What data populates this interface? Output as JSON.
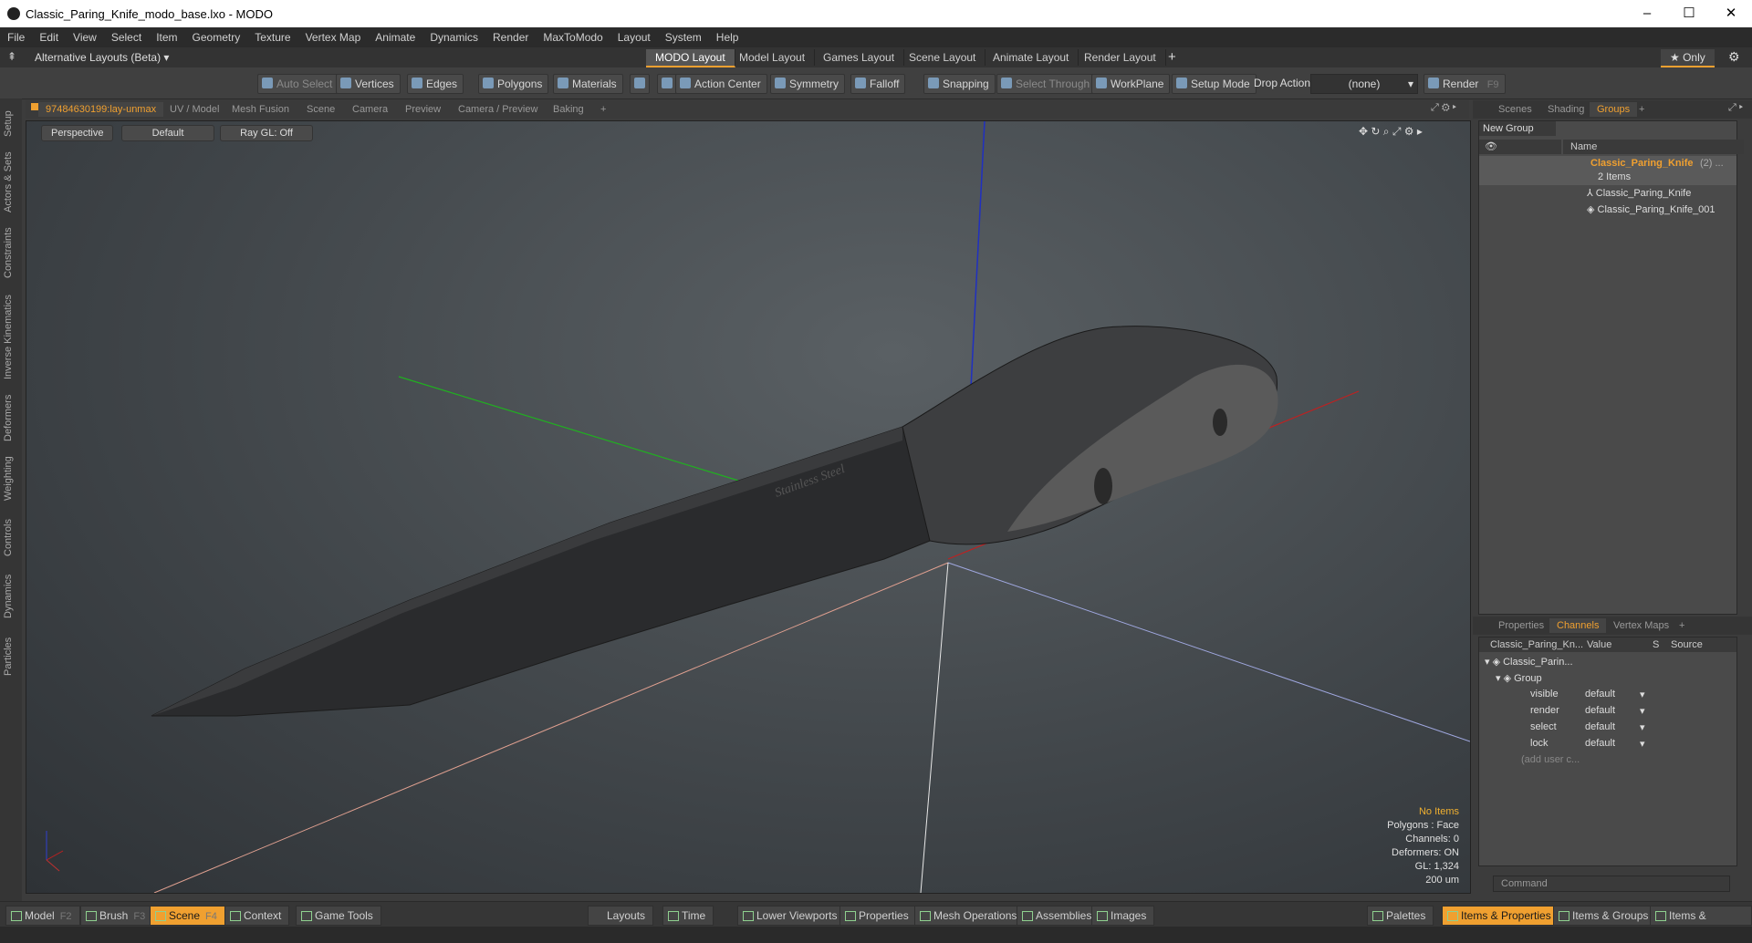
{
  "window": {
    "title": "Classic_Paring_Knife_modo_base.lxo - MODO",
    "minimize": "–",
    "maximize": "☐",
    "close": "✕"
  },
  "menu": [
    "File",
    "Edit",
    "View",
    "Select",
    "Item",
    "Geometry",
    "Texture",
    "Vertex Map",
    "Animate",
    "Dynamics",
    "Render",
    "MaxToModo",
    "Layout",
    "System",
    "Help"
  ],
  "layouts": {
    "selector": "Alternative Layouts (Beta) ▾",
    "tabs": [
      "MODO Layout",
      "Model Layout",
      "Games Layout",
      "Scene Layout",
      "Animate Layout",
      "Render Layout"
    ],
    "add": "+",
    "only": "★ Only"
  },
  "toolbar": {
    "auto_select": "Auto Select",
    "vertices": "Vertices",
    "edges": "Edges",
    "polygons": "Polygons",
    "materials": "Materials",
    "action_center": "Action Center",
    "symmetry": "Symmetry",
    "falloff": "Falloff",
    "snapping": "Snapping",
    "select_through": "Select Through",
    "workplane": "WorkPlane",
    "setup_mode": "Setup Mode",
    "drop_action": "Drop Action",
    "drop_value": "(none)",
    "render": "Render",
    "render_key": "F9"
  },
  "left_tabs": [
    "Setup",
    "Actors & Sets",
    "Constraints",
    "Inverse Kinematics",
    "Deformers",
    "Weighting",
    "Controls",
    "Dynamics",
    "Particles"
  ],
  "viewport_tabs": [
    "97484630199:lay-unmax",
    "UV / Model",
    "Mesh Fusion",
    "Scene",
    "Camera",
    "Preview",
    "Camera / Preview",
    "Baking",
    "+"
  ],
  "viewport": {
    "view": "Perspective",
    "shading": "Default",
    "raygl": "Ray GL: Off"
  },
  "stats": {
    "items": "No Items",
    "polygons": "Polygons : Face",
    "channels": "Channels: 0",
    "deformers": "Deformers: ON",
    "gl": "GL: 1,324",
    "scale": "200 um"
  },
  "right_tabs": [
    "Scenes",
    "Shading",
    "Groups",
    "+"
  ],
  "groups": {
    "new_group": "New Group",
    "name_col": "Name",
    "group_name": "Classic_Paring_Knife",
    "group_count": "(2) ...",
    "items_label": "2 Items",
    "children": [
      "Classic_Paring_Knife",
      "Classic_Paring_Knife_001"
    ]
  },
  "props_tabs": [
    "Properties",
    "Channels",
    "Vertex Maps",
    "+"
  ],
  "channels": {
    "cols": [
      "Classic_Paring_Kn...",
      "Value",
      "S",
      "Source"
    ],
    "root": "Classic_Parin...",
    "group": "Group",
    "rows": [
      {
        "name": "visible",
        "value": "default"
      },
      {
        "name": "render",
        "value": "default"
      },
      {
        "name": "select",
        "value": "default"
      },
      {
        "name": "lock",
        "value": "default"
      }
    ],
    "add_user": "(add user c..."
  },
  "command": {
    "placeholder": "Command"
  },
  "bottom": {
    "left": [
      {
        "label": "Model",
        "key": "F2"
      },
      {
        "label": "Brush",
        "key": "F3"
      },
      {
        "label": "Scene",
        "key": "F4"
      },
      {
        "label": "Context",
        "key": ""
      },
      {
        "label": "Game Tools",
        "key": ""
      }
    ],
    "center": [
      "Layouts",
      "Time",
      "Lower Viewports",
      "Properties",
      "Mesh Operations",
      "Assemblies",
      "Images"
    ],
    "right": [
      "Palettes",
      "Items & Properties",
      "Items & Groups",
      "Items & Shading"
    ]
  },
  "knife_logo": "Stainless Steel",
  "colors": {
    "accent": "#f0a030",
    "x_axis": "#d03030",
    "y_axis": "#30b030",
    "z_axis": "#3040d0"
  }
}
